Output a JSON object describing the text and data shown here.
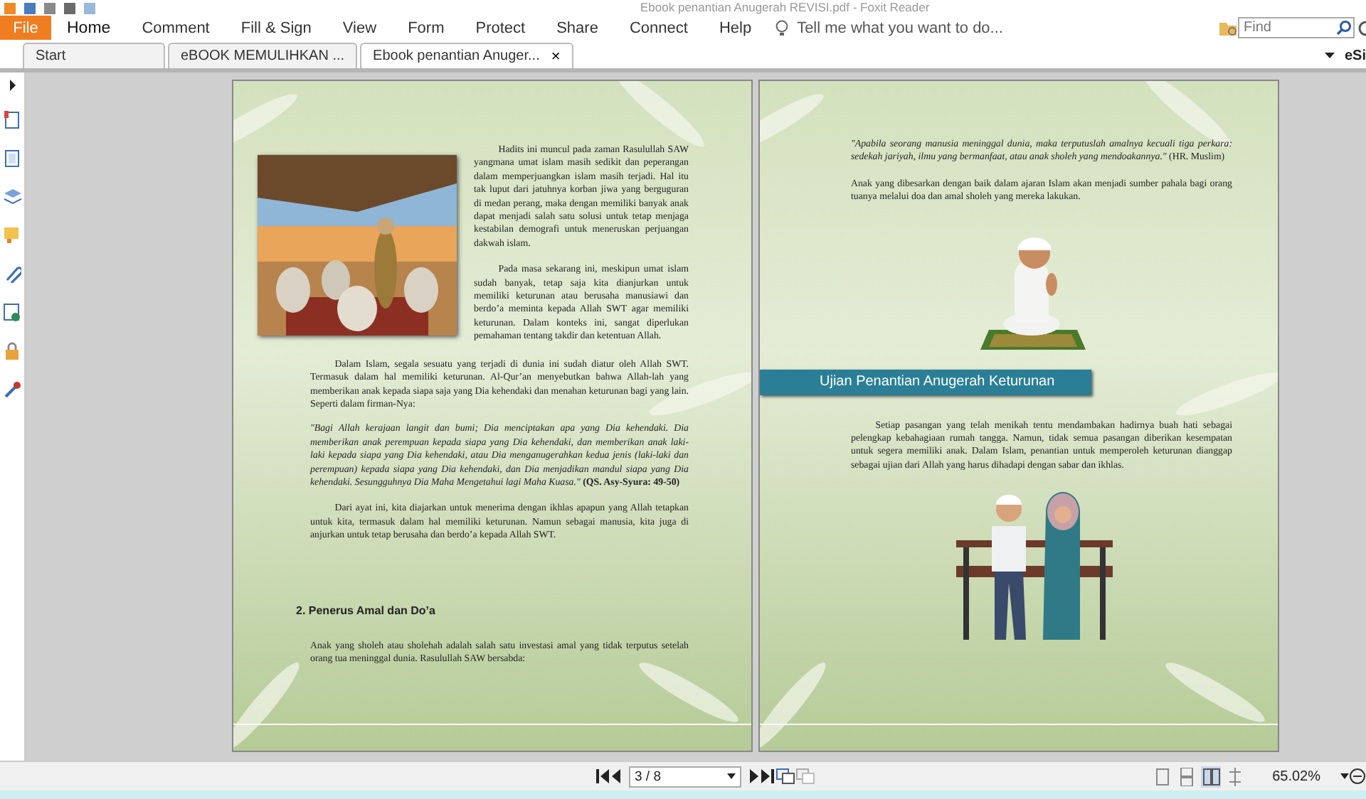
{
  "window": {
    "title": "Ebook penantian Anugerah REVISI.pdf - Foxit Reader"
  },
  "ribbon": {
    "file_label": "File",
    "tabs": [
      {
        "label": "Home",
        "selected": true
      },
      {
        "label": "Comment",
        "selected": false
      },
      {
        "label": "Fill & Sign",
        "selected": false
      },
      {
        "label": "View",
        "selected": false
      },
      {
        "label": "Form",
        "selected": false
      },
      {
        "label": "Protect",
        "selected": false
      },
      {
        "label": "Share",
        "selected": false
      },
      {
        "label": "Connect",
        "selected": false
      },
      {
        "label": "Help",
        "selected": false
      }
    ],
    "tell_me": "Tell me what you want to do...",
    "search": {
      "placeholder": "Find"
    }
  },
  "doc_tabs": [
    {
      "label": "Start",
      "selected": false
    },
    {
      "label": "eBOOK MEMULIHKAN ...",
      "selected": false
    },
    {
      "label": "Ebook penantian Anuger...",
      "selected": true,
      "close": "×"
    }
  ],
  "esign_label": "eSi",
  "pages": [
    {
      "blocks": [
        {
          "kind": "side_picture",
          "paragraphs": [
            "Hadits ini muncul pada zaman Rasulullah SAW yangmana umat islam masih sedikit dan peperangan dalam memperjuangkan islam masih terjadi. Hal itu tak luput dari jatuhnya korban jiwa yang berguguran di medan perang,  maka dengan memiliki banyak anak dapat menjadi salah satu solusi untuk tetap menjaga kestabilan demografi untuk meneruskan perjuangan dakwah islam.",
            "Pada masa sekarang ini, meskipun umat islam sudah banyak, tetap saja kita dianjurkan untuk memiliki keturunan atau berusaha manusiawi dan berdo’a meminta kepada Allah SWT agar memiliki keturunan. Dalam konteks ini, sangat diperlukan pemahaman tentang takdir dan ketentuan Allah."
          ]
        },
        {
          "kind": "paragraph",
          "text": "Dalam Islam, segala sesuatu yang terjadi di dunia ini sudah diatur oleh Allah SWT. Termasuk dalam hal memiliki keturunan. Al-Qur’an menyebutkan bahwa Allah-lah yang memberikan anak kepada siapa saja yang Dia kehendaki dan menahan keturunan bagi yang lain. Seperti dalam firman-Nya:"
        },
        {
          "kind": "quote",
          "text": "*\"Bagi Allah kerajaan langit dan bumi; Dia menciptakan apa yang Dia kehendaki. Dia memberikan anak perempuan kepada siapa yang Dia kehendaki, dan memberikan anak laki-laki kepada siapa yang Dia kehendaki, atau Dia menganugerahkan kedua jenis (laki-laki dan perempuan) kepada siapa yang Dia kehendaki, dan Dia menjadikan mandul siapa yang Dia kehendaki. Sesungguhnya Dia Maha Mengetahui lagi Maha Kuasa.\"* **(QS. Asy-Syura: 49-50)**"
        },
        {
          "kind": "paragraph",
          "text": "Dari ayat ini, kita diajarkan untuk menerima dengan ikhlas apapun yang Allah tetapkan untuk kita, termasuk dalam hal memiliki keturunan. Namun sebagai manusia, kita juga di anjurkan untuk tetap berusaha dan berdo’a kepada Allah SWT."
        },
        {
          "kind": "heading",
          "text": "2.  Penerus Amal dan Do’a"
        },
        {
          "kind": "plain",
          "text": "Anak yang sholeh atau sholehah adalah salah satu investasi amal yang tidak terputus setelah orang tua meninggal dunia. Rasulullah SAW bersabda:"
        }
      ]
    },
    {
      "blocks": [
        {
          "kind": "quote",
          "text": "*\"Apabila seorang manusia meninggal dunia, maka terputuslah amalnya kecuali tiga perkara: sedekah jariyah, ilmu yang bermanfaat, atau anak sholeh yang mendoakannya.\"* (HR. Muslim)"
        },
        {
          "kind": "plain",
          "text": "Anak yang dibesarkan dengan baik dalam ajaran Islam akan menjadi sumber pahala bagi orang tuanya melalui doa dan amal sholeh yang mereka lakukan."
        },
        {
          "kind": "picture"
        },
        {
          "kind": "banner",
          "text": "Ujian Penantian Anugerah Keturunan"
        },
        {
          "kind": "paragraph",
          "text": "Setiap pasangan yang telah menikah tentu mendambakan hadirnya buah hati sebagai pelengkap kebahagiaan rumah tangga. Namun, tidak semua pasangan diberikan kesempatan untuk segera memiliki anak. Dalam Islam, penantian untuk memperoleh keturunan dianggap sebagai ujian dari Allah yang harus dihadapi dengan sabar dan ikhlas."
        },
        {
          "kind": "picture"
        }
      ]
    }
  ],
  "status_bar": {
    "page_field": "3 / 8",
    "view_modes": [
      {
        "selected": false
      },
      {
        "selected": false
      },
      {
        "selected": true
      },
      {
        "selected": false
      }
    ],
    "zoom": "65.02%"
  }
}
